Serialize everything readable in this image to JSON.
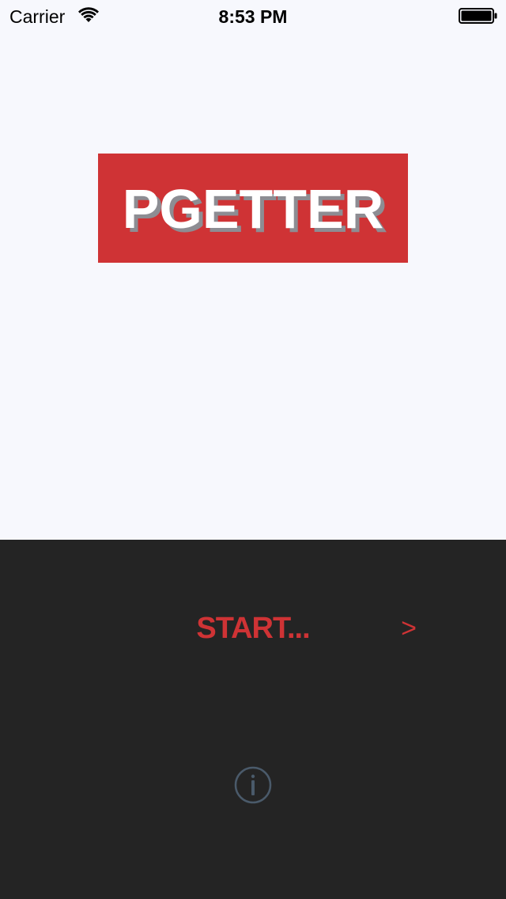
{
  "status_bar": {
    "carrier": "Carrier",
    "time": "8:53 PM",
    "wifi_icon": "wifi-icon",
    "battery_icon": "battery-icon"
  },
  "logo": {
    "text": "PGETTER",
    "background_color": "#cf3335",
    "text_color": "#ffffff"
  },
  "controls": {
    "start_label": "START...",
    "next_label": ">",
    "info_icon": "info-icon",
    "accent_color": "#cf3335",
    "panel_color": "#242424"
  }
}
